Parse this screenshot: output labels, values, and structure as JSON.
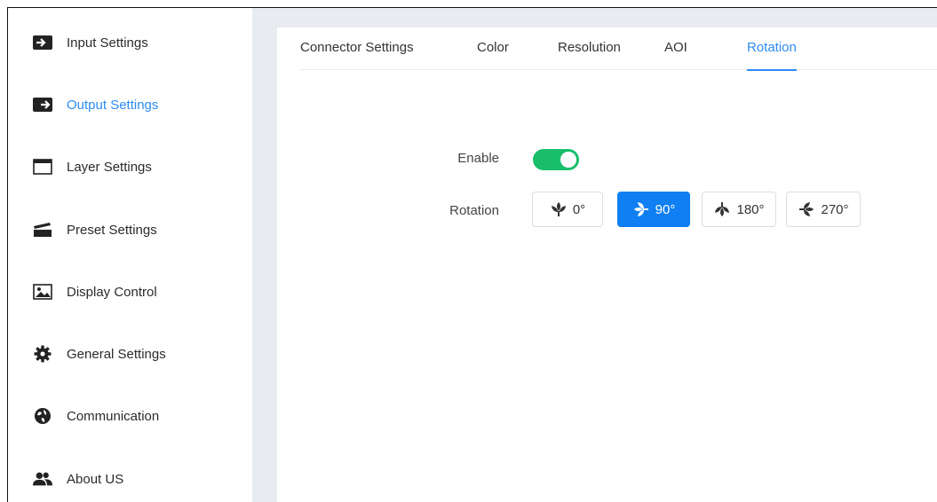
{
  "colors": {
    "accent": "#2d8cf0",
    "toggle_on": "#19be6b",
    "active_button": "#0f7ff3",
    "panel_gray": "#e8ecf1"
  },
  "sidebar": {
    "items": [
      {
        "label": "Input Settings",
        "icon": "input-arrow-icon"
      },
      {
        "label": "Output Settings",
        "icon": "output-arrow-icon",
        "active": true
      },
      {
        "label": "Layer Settings",
        "icon": "window-icon"
      },
      {
        "label": "Preset Settings",
        "icon": "clapperboard-icon"
      },
      {
        "label": "Display Control",
        "icon": "image-icon"
      },
      {
        "label": "General Settings",
        "icon": "gear-icon"
      },
      {
        "label": "Communication",
        "icon": "globe-icon"
      },
      {
        "label": "About US",
        "icon": "users-icon"
      }
    ]
  },
  "tabs": [
    {
      "label": "Connector Settings"
    },
    {
      "label": "Color"
    },
    {
      "label": "Resolution"
    },
    {
      "label": "AOI"
    },
    {
      "label": "Rotation",
      "active": true
    }
  ],
  "form": {
    "enable_label": "Enable",
    "enable_value": true,
    "rotation_label": "Rotation",
    "rotation_options": [
      {
        "label": "0°",
        "icon": "leaf-up-icon"
      },
      {
        "label": "90°",
        "icon": "leaf-left-icon",
        "selected": true
      },
      {
        "label": "180°",
        "icon": "leaf-down-icon"
      },
      {
        "label": "270°",
        "icon": "leaf-right-icon"
      }
    ]
  }
}
